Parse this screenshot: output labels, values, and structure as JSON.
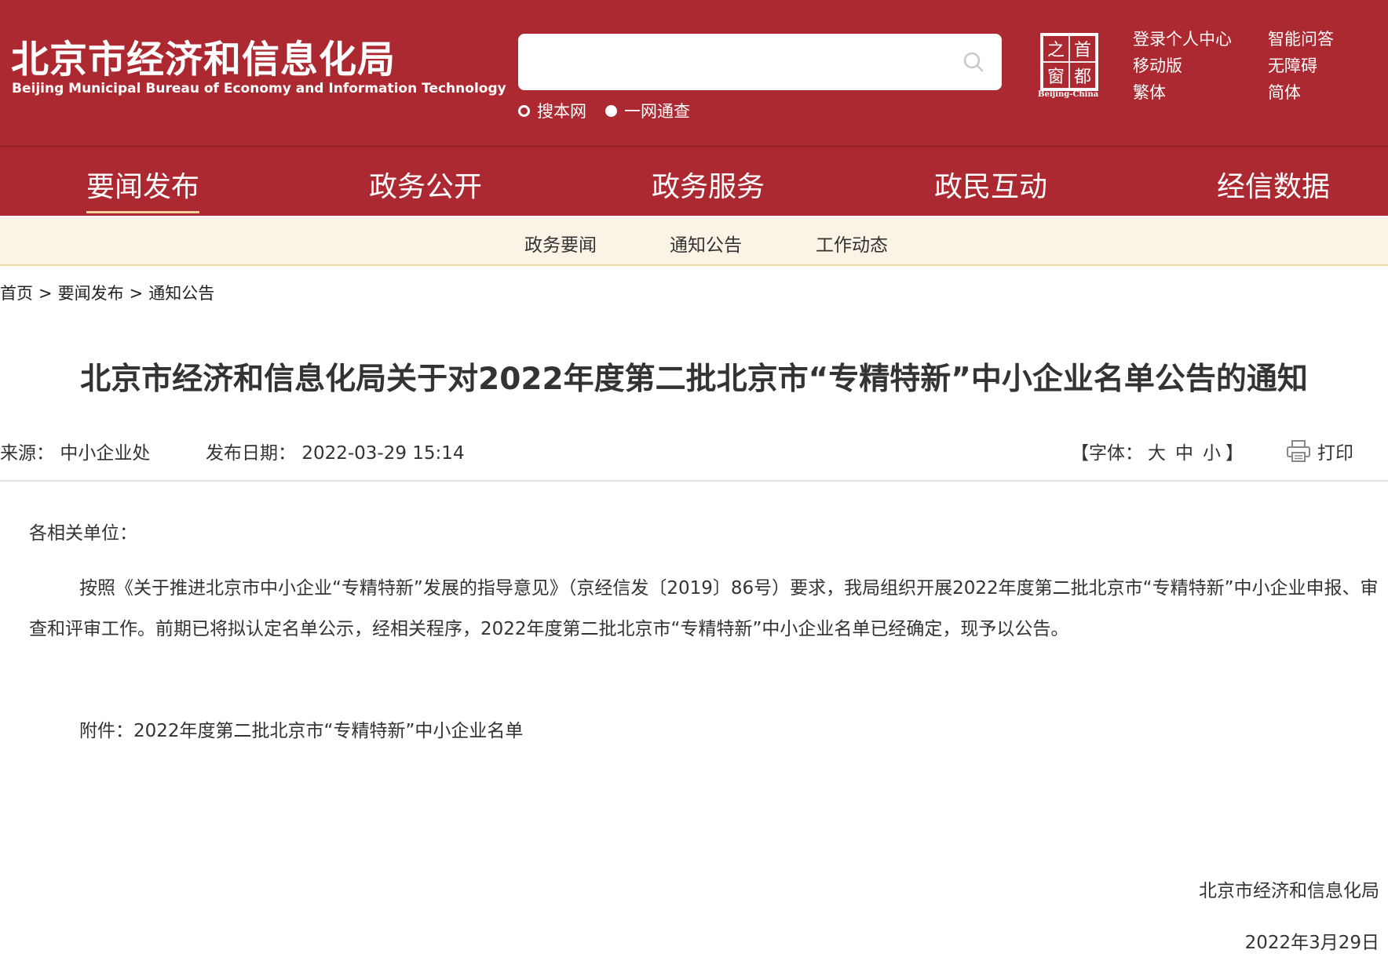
{
  "header": {
    "logo_cn": "北京市经济和信息化局",
    "logo_en": "Beijing Municipal Bureau of Economy and Information Technology",
    "search": {
      "value": "",
      "placeholder": "",
      "scopes": [
        "搜本网",
        "一网通查"
      ]
    },
    "emblem": {
      "chars": [
        "之",
        "首",
        "窗",
        "都"
      ],
      "caption": "Beijing-China"
    },
    "links": [
      "登录个人中心",
      "智能问答",
      "移动版",
      "无障碍",
      "繁体",
      "简体"
    ]
  },
  "nav": {
    "items": [
      "要闻发布",
      "政务公开",
      "政务服务",
      "政民互动",
      "经信数据"
    ],
    "active": "要闻发布"
  },
  "subnav": {
    "items": [
      "政务要闻",
      "通知公告",
      "工作动态"
    ]
  },
  "breadcrumb": [
    "首页",
    "要闻发布",
    "通知公告"
  ],
  "breadcrumb_sep": ">",
  "article": {
    "title": "北京市经济和信息化局关于对2022年度第二批北京市“专精特新”中小企业名单公告的通知",
    "source_label": "来源：",
    "source": "中小企业处",
    "date_label": "发布日期：",
    "date": "2022-03-29 15:14",
    "font_label_open": "【字体：",
    "font_sizes": [
      "大",
      "中",
      "小"
    ],
    "font_label_close": "】",
    "print_label": "打印",
    "salutation": "各相关单位：",
    "body": "按照《关于推进北京市中小企业“专精特新”发展的指导意见》（京经信发〔2019〕86号）要求，我局组织开展2022年度第二批北京市“专精特新”中小企业申报、审查和评审工作。前期已将拟认定名单公示，经相关程序，2022年度第二批北京市“专精特新”中小企业名单已经确定，现予以公告。",
    "attachment": "附件：2022年度第二批北京市“专精特新”中小企业名单",
    "signature_org": "北京市经济和信息化局",
    "signature_date": "2022年3月29日"
  },
  "colors": {
    "header_red": "#ad2931",
    "subnav_bg": "#fbf3e6",
    "active_underline": "#f1d29a"
  }
}
